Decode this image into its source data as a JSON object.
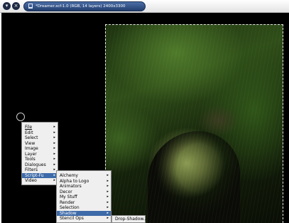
{
  "window": {
    "title": "*Dreamer.xcf-1.0 (RGB, 14 layers) 2400x3300",
    "menu_button_glyph": "▾",
    "close_button_glyph": "×"
  },
  "image_menu": {
    "items": [
      {
        "label": "File",
        "submenu": true
      },
      {
        "label": "Edit",
        "submenu": true
      },
      {
        "label": "Select",
        "submenu": true
      },
      {
        "label": "View",
        "submenu": true
      },
      {
        "label": "Image",
        "submenu": true
      },
      {
        "label": "Layer",
        "submenu": true
      },
      {
        "label": "Tools",
        "submenu": true
      },
      {
        "label": "Dialogues",
        "submenu": true
      },
      {
        "label": "Filters",
        "submenu": true
      },
      {
        "label": "Script-Fu",
        "submenu": true,
        "active": true
      },
      {
        "label": "Video",
        "submenu": true
      }
    ]
  },
  "scriptfu_menu": {
    "items": [
      {
        "label": "Alchemy",
        "submenu": true
      },
      {
        "label": "Alpha to Logo",
        "submenu": true
      },
      {
        "label": "Animators",
        "submenu": true
      },
      {
        "label": "Decor",
        "submenu": true
      },
      {
        "label": "My Stuff",
        "submenu": true
      },
      {
        "label": "Render",
        "submenu": true
      },
      {
        "label": "Selection",
        "submenu": true
      },
      {
        "label": "Shadow",
        "submenu": true,
        "active": true
      },
      {
        "label": "Stencil Ops",
        "submenu": true
      }
    ]
  },
  "shadow_menu": {
    "items": [
      {
        "label": "Drop-Shadow..."
      }
    ]
  },
  "arrow_glyph": "▸"
}
